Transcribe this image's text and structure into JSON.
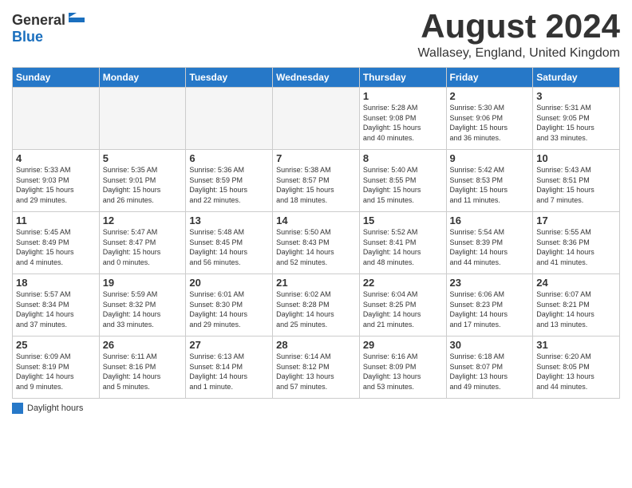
{
  "header": {
    "logo_general": "General",
    "logo_blue": "Blue",
    "month_title": "August 2024",
    "location": "Wallasey, England, United Kingdom"
  },
  "legend": {
    "label": "Daylight hours"
  },
  "weekdays": [
    "Sunday",
    "Monday",
    "Tuesday",
    "Wednesday",
    "Thursday",
    "Friday",
    "Saturday"
  ],
  "weeks": [
    [
      {
        "day": "",
        "info": ""
      },
      {
        "day": "",
        "info": ""
      },
      {
        "day": "",
        "info": ""
      },
      {
        "day": "",
        "info": ""
      },
      {
        "day": "1",
        "info": "Sunrise: 5:28 AM\nSunset: 9:08 PM\nDaylight: 15 hours\nand 40 minutes."
      },
      {
        "day": "2",
        "info": "Sunrise: 5:30 AM\nSunset: 9:06 PM\nDaylight: 15 hours\nand 36 minutes."
      },
      {
        "day": "3",
        "info": "Sunrise: 5:31 AM\nSunset: 9:05 PM\nDaylight: 15 hours\nand 33 minutes."
      }
    ],
    [
      {
        "day": "4",
        "info": "Sunrise: 5:33 AM\nSunset: 9:03 PM\nDaylight: 15 hours\nand 29 minutes."
      },
      {
        "day": "5",
        "info": "Sunrise: 5:35 AM\nSunset: 9:01 PM\nDaylight: 15 hours\nand 26 minutes."
      },
      {
        "day": "6",
        "info": "Sunrise: 5:36 AM\nSunset: 8:59 PM\nDaylight: 15 hours\nand 22 minutes."
      },
      {
        "day": "7",
        "info": "Sunrise: 5:38 AM\nSunset: 8:57 PM\nDaylight: 15 hours\nand 18 minutes."
      },
      {
        "day": "8",
        "info": "Sunrise: 5:40 AM\nSunset: 8:55 PM\nDaylight: 15 hours\nand 15 minutes."
      },
      {
        "day": "9",
        "info": "Sunrise: 5:42 AM\nSunset: 8:53 PM\nDaylight: 15 hours\nand 11 minutes."
      },
      {
        "day": "10",
        "info": "Sunrise: 5:43 AM\nSunset: 8:51 PM\nDaylight: 15 hours\nand 7 minutes."
      }
    ],
    [
      {
        "day": "11",
        "info": "Sunrise: 5:45 AM\nSunset: 8:49 PM\nDaylight: 15 hours\nand 4 minutes."
      },
      {
        "day": "12",
        "info": "Sunrise: 5:47 AM\nSunset: 8:47 PM\nDaylight: 15 hours\nand 0 minutes."
      },
      {
        "day": "13",
        "info": "Sunrise: 5:48 AM\nSunset: 8:45 PM\nDaylight: 14 hours\nand 56 minutes."
      },
      {
        "day": "14",
        "info": "Sunrise: 5:50 AM\nSunset: 8:43 PM\nDaylight: 14 hours\nand 52 minutes."
      },
      {
        "day": "15",
        "info": "Sunrise: 5:52 AM\nSunset: 8:41 PM\nDaylight: 14 hours\nand 48 minutes."
      },
      {
        "day": "16",
        "info": "Sunrise: 5:54 AM\nSunset: 8:39 PM\nDaylight: 14 hours\nand 44 minutes."
      },
      {
        "day": "17",
        "info": "Sunrise: 5:55 AM\nSunset: 8:36 PM\nDaylight: 14 hours\nand 41 minutes."
      }
    ],
    [
      {
        "day": "18",
        "info": "Sunrise: 5:57 AM\nSunset: 8:34 PM\nDaylight: 14 hours\nand 37 minutes."
      },
      {
        "day": "19",
        "info": "Sunrise: 5:59 AM\nSunset: 8:32 PM\nDaylight: 14 hours\nand 33 minutes."
      },
      {
        "day": "20",
        "info": "Sunrise: 6:01 AM\nSunset: 8:30 PM\nDaylight: 14 hours\nand 29 minutes."
      },
      {
        "day": "21",
        "info": "Sunrise: 6:02 AM\nSunset: 8:28 PM\nDaylight: 14 hours\nand 25 minutes."
      },
      {
        "day": "22",
        "info": "Sunrise: 6:04 AM\nSunset: 8:25 PM\nDaylight: 14 hours\nand 21 minutes."
      },
      {
        "day": "23",
        "info": "Sunrise: 6:06 AM\nSunset: 8:23 PM\nDaylight: 14 hours\nand 17 minutes."
      },
      {
        "day": "24",
        "info": "Sunrise: 6:07 AM\nSunset: 8:21 PM\nDaylight: 14 hours\nand 13 minutes."
      }
    ],
    [
      {
        "day": "25",
        "info": "Sunrise: 6:09 AM\nSunset: 8:19 PM\nDaylight: 14 hours\nand 9 minutes."
      },
      {
        "day": "26",
        "info": "Sunrise: 6:11 AM\nSunset: 8:16 PM\nDaylight: 14 hours\nand 5 minutes."
      },
      {
        "day": "27",
        "info": "Sunrise: 6:13 AM\nSunset: 8:14 PM\nDaylight: 14 hours\nand 1 minute."
      },
      {
        "day": "28",
        "info": "Sunrise: 6:14 AM\nSunset: 8:12 PM\nDaylight: 13 hours\nand 57 minutes."
      },
      {
        "day": "29",
        "info": "Sunrise: 6:16 AM\nSunset: 8:09 PM\nDaylight: 13 hours\nand 53 minutes."
      },
      {
        "day": "30",
        "info": "Sunrise: 6:18 AM\nSunset: 8:07 PM\nDaylight: 13 hours\nand 49 minutes."
      },
      {
        "day": "31",
        "info": "Sunrise: 6:20 AM\nSunset: 8:05 PM\nDaylight: 13 hours\nand 44 minutes."
      }
    ]
  ]
}
